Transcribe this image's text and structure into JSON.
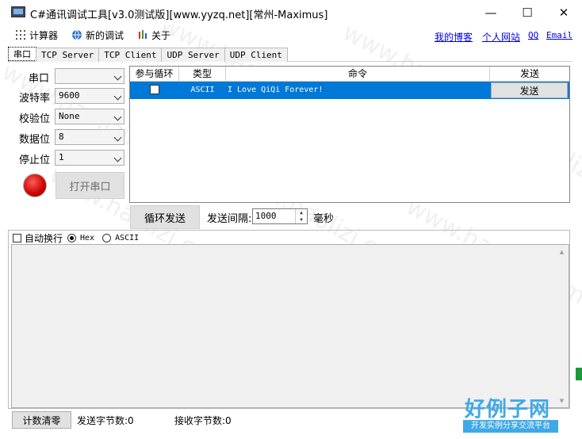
{
  "window": {
    "title": "C#通讯调试工具[v3.0测试版][www.yyzq.net][常州-Maximus]",
    "minimize": "—",
    "maximize": "☐",
    "close": "✕"
  },
  "menu": {
    "calculator": "计算器",
    "new_debug": "新的调试",
    "about": "关于"
  },
  "links": {
    "blog": "我的博客",
    "website": "个人网站",
    "qq": "QQ",
    "email": "Email"
  },
  "tabs": [
    "串口",
    "TCP Server",
    "TCP Client",
    "UDP Server",
    "UDP Client"
  ],
  "serial": {
    "port_label": "串口",
    "port_value": "",
    "baud_label": "波特率",
    "baud_value": "9600",
    "parity_label": "校验位",
    "parity_value": "None",
    "databits_label": "数据位",
    "databits_value": "8",
    "stopbits_label": "停止位",
    "stopbits_value": "1",
    "open_button": "打开串口"
  },
  "grid": {
    "headers": [
      "参与循环",
      "类型",
      "命令",
      "发送"
    ],
    "rows": [
      {
        "loop": false,
        "type": "ASCII",
        "command": "I Love QiQi Forever!",
        "send": "发送"
      }
    ]
  },
  "loop": {
    "button": "循环发送",
    "interval_label": "发送间隔:",
    "interval_value": "1000",
    "unit": "毫秒"
  },
  "receive": {
    "auto_wrap": "自动换行",
    "hex": "Hex",
    "ascii": "ASCII"
  },
  "status": {
    "clear_button": "计数清零",
    "sent_bytes": "发送字节数:0",
    "recv_bytes": "接收字节数:0"
  },
  "watermark": {
    "text": "www.haolizi.com",
    "logo": "好例子网",
    "logo_sub": "开发实例分享交流平台"
  },
  "colors": {
    "selection": "#0078d7",
    "link": "#0000ee",
    "led": "#cc0000",
    "logo": "#3fa9e8"
  }
}
